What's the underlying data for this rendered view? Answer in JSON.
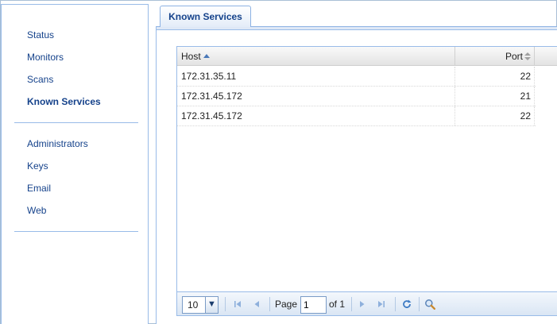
{
  "sidebar": {
    "group1": [
      {
        "label": "Status",
        "active": false
      },
      {
        "label": "Monitors",
        "active": false
      },
      {
        "label": "Scans",
        "active": false
      },
      {
        "label": "Known Services",
        "active": true
      }
    ],
    "group2": [
      {
        "label": "Administrators",
        "active": false
      },
      {
        "label": "Keys",
        "active": false
      },
      {
        "label": "Email",
        "active": false
      },
      {
        "label": "Web",
        "active": false
      }
    ]
  },
  "tabs": {
    "active_label": "Known Services"
  },
  "grid": {
    "columns": {
      "host": "Host",
      "port": "Port"
    },
    "rows": [
      {
        "host": "172.31.35.11",
        "port": "22"
      },
      {
        "host": "172.31.45.172",
        "port": "21"
      },
      {
        "host": "172.31.45.172",
        "port": "22"
      }
    ]
  },
  "pager": {
    "page_size": "10",
    "page_label": "Page",
    "current_page": "1",
    "of_label": "of 1"
  },
  "colors": {
    "accent": "#15428b",
    "border": "#99bbe8",
    "toolbar_icon": "#4a84c8"
  },
  "icons": {
    "first": "first-page-icon",
    "prev": "previous-page-icon",
    "next": "next-page-icon",
    "last": "last-page-icon",
    "refresh": "refresh-icon",
    "search": "search-icon"
  }
}
